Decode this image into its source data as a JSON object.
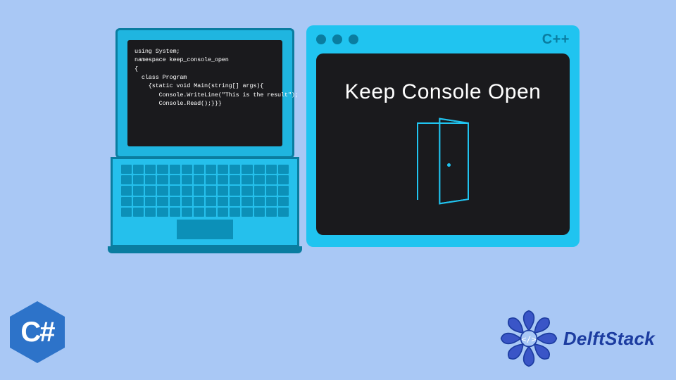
{
  "laptop": {
    "code": [
      "using System;",
      "",
      "namespace keep_console_open",
      "{",
      "  class Program",
      "    {static void Main(string[] args){",
      "       Console.WriteLine(\"This is the result\");",
      "       Console.Read();}}}"
    ]
  },
  "console": {
    "lang_label": "C++",
    "title": "Keep Console Open"
  },
  "badges": {
    "csharp": "C#",
    "brand": "DelftStack"
  },
  "colors": {
    "bg": "#a9c8f5",
    "accent": "#20c4f0",
    "accent_dark": "#0a7da0",
    "dark": "#1a1a1d",
    "brand_blue": "#1c3ca0",
    "badge_blue": "#2d73c9"
  }
}
